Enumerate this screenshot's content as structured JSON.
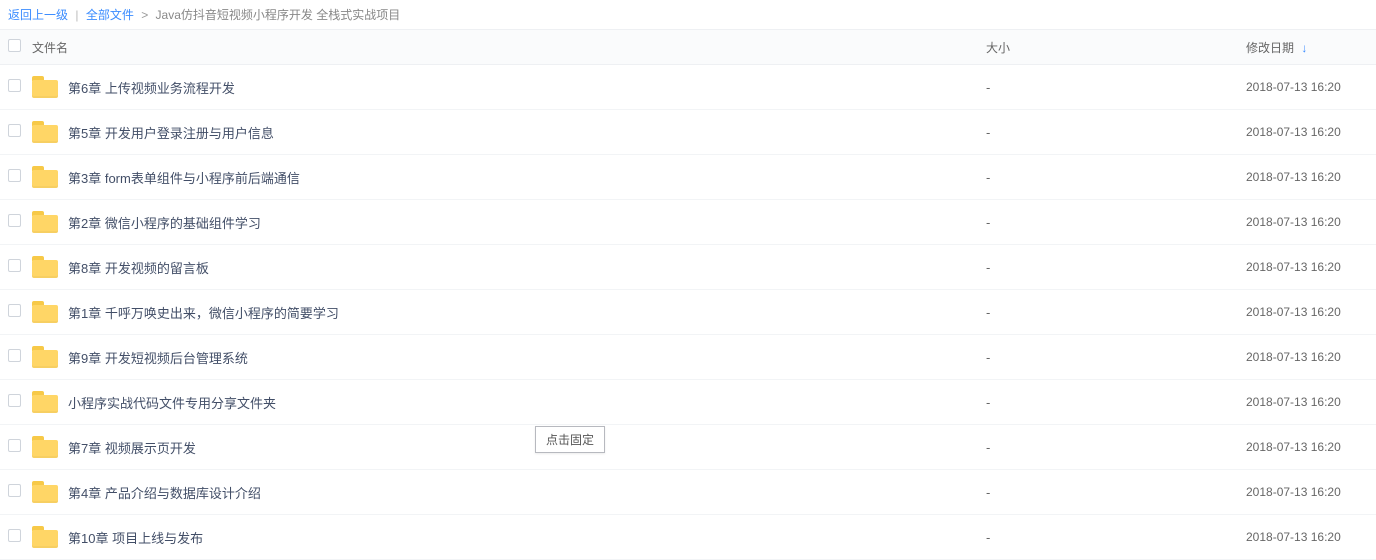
{
  "breadcrumb": {
    "back": "返回上一级",
    "root": "全部文件",
    "current": "Java仿抖音短视频小程序开发 全栈式实战项目"
  },
  "columns": {
    "name": "文件名",
    "size": "大小",
    "date": "修改日期"
  },
  "tooltip": "点击固定",
  "rows": [
    {
      "name": "第6章 上传视频业务流程开发",
      "size": "-",
      "date": "2018-07-13 16:20"
    },
    {
      "name": "第5章 开发用户登录注册与用户信息",
      "size": "-",
      "date": "2018-07-13 16:20"
    },
    {
      "name": "第3章 form表单组件与小程序前后端通信",
      "size": "-",
      "date": "2018-07-13 16:20"
    },
    {
      "name": "第2章 微信小程序的基础组件学习",
      "size": "-",
      "date": "2018-07-13 16:20"
    },
    {
      "name": "第8章 开发视频的留言板",
      "size": "-",
      "date": "2018-07-13 16:20"
    },
    {
      "name": "第1章 千呼万唤史出来，微信小程序的简要学习",
      "size": "-",
      "date": "2018-07-13 16:20"
    },
    {
      "name": "第9章 开发短视频后台管理系统",
      "size": "-",
      "date": "2018-07-13 16:20"
    },
    {
      "name": "小程序实战代码文件专用分享文件夹",
      "size": "-",
      "date": "2018-07-13 16:20"
    },
    {
      "name": "第7章 视频展示页开发",
      "size": "-",
      "date": "2018-07-13 16:20"
    },
    {
      "name": "第4章 产品介绍与数据库设计介绍",
      "size": "-",
      "date": "2018-07-13 16:20"
    },
    {
      "name": "第10章 项目上线与发布",
      "size": "-",
      "date": "2018-07-13 16:20"
    }
  ]
}
